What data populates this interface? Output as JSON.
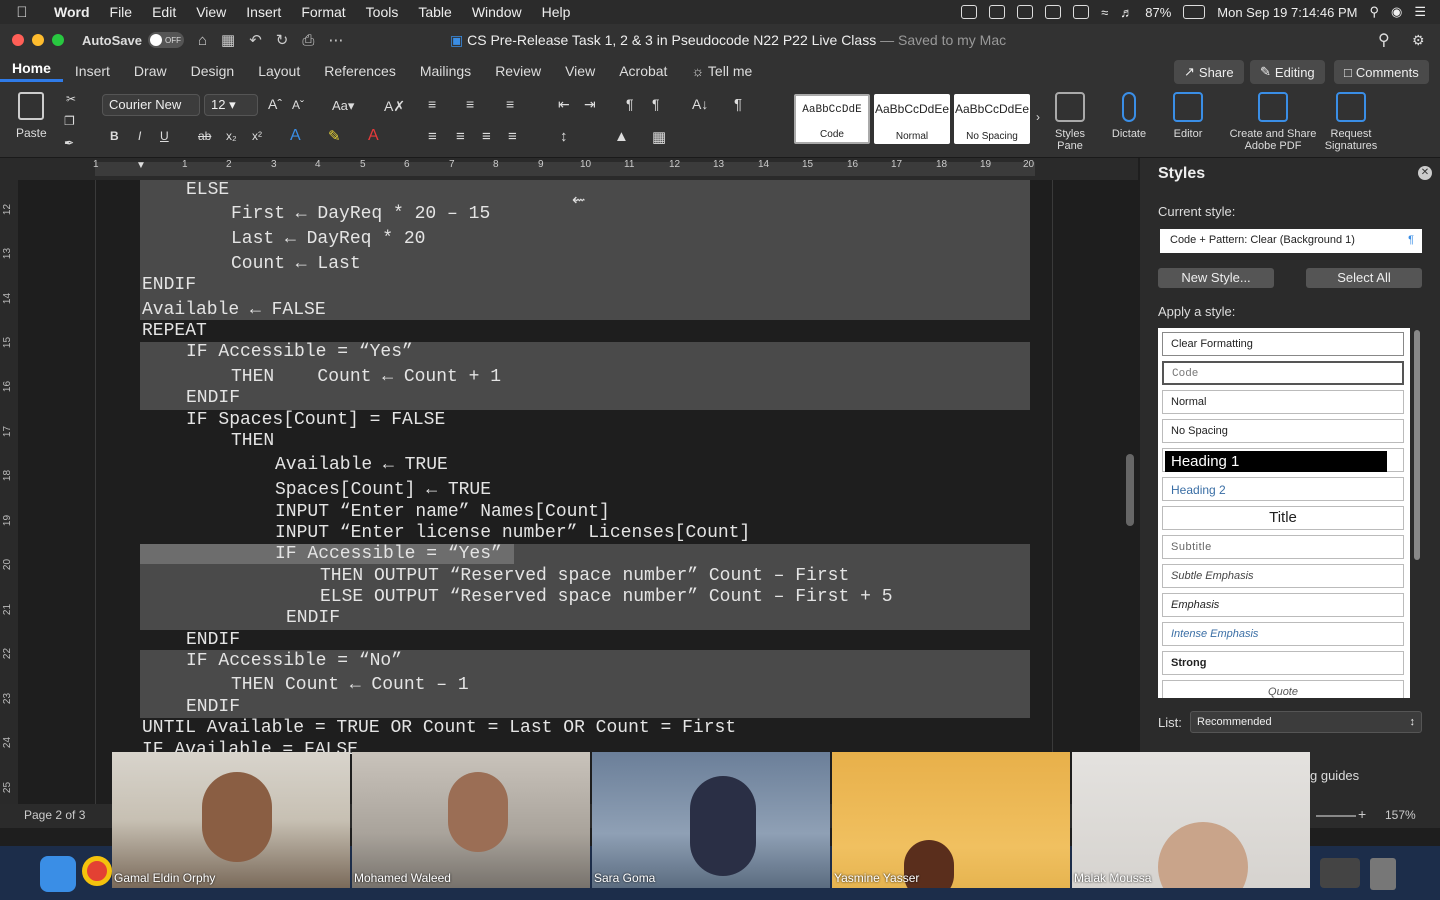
{
  "menubar": {
    "app": "Word",
    "items": [
      "File",
      "Edit",
      "View",
      "Insert",
      "Format",
      "Tools",
      "Table",
      "Window",
      "Help"
    ],
    "battery": "87%",
    "datetime": "Mon Sep 19  7:14:46 PM"
  },
  "titlebar": {
    "autosave_label": "AutoSave",
    "autosave_state": "OFF",
    "doc_title": "CS Pre-Release Task 1, 2 & 3 in Pseudocode N22 P22 Live Class",
    "saved_status": "— Saved to my Mac"
  },
  "ribbon_tabs": [
    "Home",
    "Insert",
    "Draw",
    "Design",
    "Layout",
    "References",
    "Mailings",
    "Review",
    "View",
    "Acrobat"
  ],
  "tell_me": "Tell me",
  "top_buttons": {
    "share": "Share",
    "editing": "Editing",
    "comments": "Comments"
  },
  "ribbon": {
    "paste_label": "Paste",
    "font_name": "Courier New",
    "font_size": "12",
    "styles_gallery": [
      {
        "sample": "AaBbCcDdE",
        "name": "Code"
      },
      {
        "sample": "AaBbCcDdEe",
        "name": "Normal"
      },
      {
        "sample": "AaBbCcDdEe",
        "name": "No Spacing"
      }
    ],
    "styles_pane_label": "Styles Pane",
    "dictate_label": "Dictate",
    "editor_label": "Editor",
    "adobe_label": "Create and Share Adobe PDF",
    "signatures_label": "Request Signatures"
  },
  "ruler_numbers": [
    "1",
    "1",
    "2",
    "3",
    "4",
    "5",
    "6",
    "7",
    "8",
    "9",
    "10",
    "11",
    "12",
    "13",
    "14",
    "15",
    "16",
    "17",
    "18",
    "19",
    "20"
  ],
  "vruler_numbers": [
    "12",
    "13",
    "14",
    "15",
    "16",
    "17",
    "18",
    "19",
    "20",
    "21",
    "22",
    "23",
    "24",
    "25"
  ],
  "code_lines": [
    "ELSE",
    "First ← DayReq * 20 – 15",
    "Last ← DayReq * 20",
    "Count ← Last",
    "ENDIF",
    "Available ← FALSE",
    "REPEAT",
    "IF Accessible = “Yes”",
    "THEN    Count ← Count + 1",
    "ENDIF",
    "IF Spaces[Count] = FALSE",
    "THEN",
    "Available ← TRUE",
    "Spaces[Count] ← TRUE",
    "INPUT “Enter name” Names[Count]",
    "INPUT “Enter license number” Licenses[Count]",
    "IF Accessible = “Yes”",
    "THEN OUTPUT “Reserved space number” Count – First",
    "ELSE OUTPUT “Reserved space number” Count – First + 5",
    "ENDIF",
    "ENDIF",
    "IF Accessible = “No”",
    "THEN Count ← Count – 1",
    "ENDIF",
    "UNTIL Available = TRUE OR Count = Last OR Count = First",
    "IF Available = FALSE"
  ],
  "styles_pane": {
    "title": "Styles",
    "current_style_label": "Current style:",
    "current_style": "Code + Pattern: Clear (Background 1)",
    "new_style": "New Style...",
    "select_all": "Select All",
    "apply_label": "Apply a style:",
    "styles": [
      "Clear Formatting",
      "Code",
      "Normal",
      "No Spacing",
      "Heading 1",
      "Heading 2",
      "Title",
      "Subtitle",
      "Subtle Emphasis",
      "Emphasis",
      "Intense Emphasis",
      "Strong",
      "Quote"
    ],
    "list_label": "List:",
    "list_value": "Recommended",
    "guides_text": "g guides"
  },
  "status": {
    "page": "Page 2 of 3",
    "zoom": "157%"
  },
  "participants": [
    "Gamal Eldin Orphy",
    "Mohamed Waleed",
    "Sara Goma",
    "Yasmine Yasser",
    "Malak Moussa"
  ]
}
